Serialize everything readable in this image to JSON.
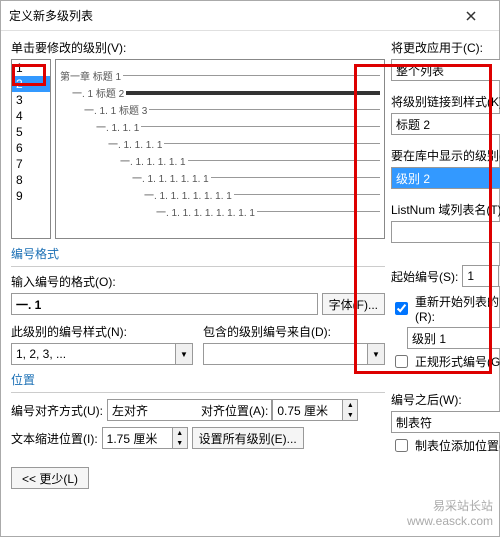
{
  "titlebar": {
    "title": "定义新多级列表"
  },
  "left": {
    "modify_label": "单击要修改的级别(V):",
    "levels": [
      "1",
      "2",
      "3",
      "4",
      "5",
      "6",
      "7",
      "8",
      "9"
    ],
    "selected_index": 1,
    "preview": [
      {
        "indent": 0,
        "text": "第一章 标题 1"
      },
      {
        "indent": 1,
        "text": "一. 1 标题 2",
        "thick": true
      },
      {
        "indent": 2,
        "text": "一. 1. 1 标题 3"
      },
      {
        "indent": 3,
        "text": "一. 1. 1. 1"
      },
      {
        "indent": 4,
        "text": "一. 1. 1. 1. 1"
      },
      {
        "indent": 5,
        "text": "一. 1. 1. 1. 1. 1"
      },
      {
        "indent": 6,
        "text": "一. 1. 1. 1. 1. 1. 1"
      },
      {
        "indent": 7,
        "text": "一. 1. 1. 1. 1. 1. 1. 1"
      },
      {
        "indent": 8,
        "text": "一. 1. 1. 1. 1. 1. 1. 1. 1"
      }
    ],
    "numfmt_section": "编号格式",
    "numfmt_label": "输入编号的格式(O):",
    "numfmt_value": "一. 1",
    "font_btn": "字体(F)...",
    "numstyle_label": "此级别的编号样式(N):",
    "numstyle_value": "1, 2, 3, ...",
    "include_label": "包含的级别编号来自(D):",
    "include_value": "",
    "pos_section": "位置",
    "align_label": "编号对齐方式(U):",
    "align_value": "左对齐",
    "align_at_label": "对齐位置(A):",
    "align_at_value": "0.75 厘米",
    "indent_label": "文本缩进位置(I):",
    "indent_value": "1.75 厘米",
    "setall_btn": "设置所有级别(E)...",
    "less_btn": "<< 更少(L)"
  },
  "right": {
    "apply_label": "将更改应用于(C):",
    "apply_value": "整个列表",
    "link_label": "将级别链接到样式(K):",
    "link_value": "标题 2",
    "gallery_label": "要在库中显示的级别(H):",
    "gallery_value": "级别 2",
    "listnum_label": "ListNum 域列表名(T):",
    "listnum_value": "",
    "start_label": "起始编号(S):",
    "start_value": "1",
    "restart_cb": "重新开始列表的间隔(R):",
    "restart_checked": true,
    "restart_value": "级别 1",
    "legal_cb": "正规形式编号(G)",
    "legal_checked": false,
    "follow_label": "编号之后(W):",
    "follow_value": "制表符",
    "tabstop_cb": "制表位添加位置(B):",
    "tabstop_checked": false
  },
  "watermark": {
    "line1": "易采站长站",
    "line2": "www.easck.com"
  }
}
